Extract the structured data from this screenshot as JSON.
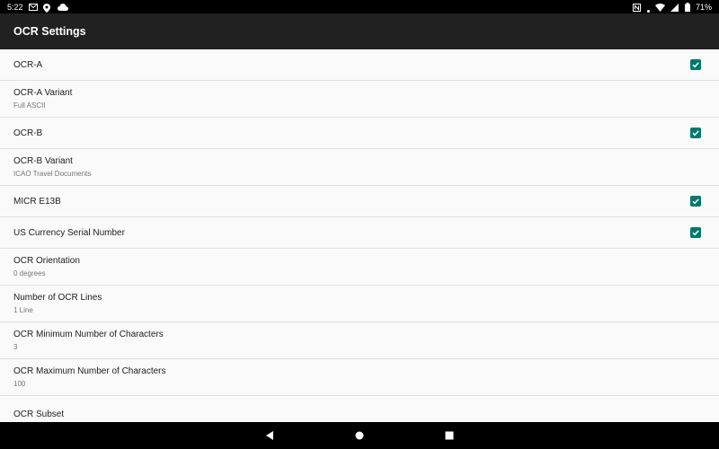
{
  "status_bar": {
    "time": "5:22",
    "battery": "71%",
    "left_icons": [
      "gmail-icon",
      "location-icon",
      "cloud-icon"
    ],
    "right_icons": [
      "nfc-icon",
      "dot-icon",
      "wifi-icon",
      "signal-icon",
      "battery-icon"
    ]
  },
  "app_bar": {
    "title": "OCR Settings"
  },
  "accent_color": "#00796b",
  "settings": {
    "items": [
      {
        "title": "OCR-A",
        "checked": true
      },
      {
        "title": "OCR-A Variant",
        "subtitle": "Full ASCII"
      },
      {
        "title": "OCR-B",
        "checked": true
      },
      {
        "title": "OCR-B Variant",
        "subtitle": "ICAO Travel Documents"
      },
      {
        "title": "MICR E13B",
        "checked": true
      },
      {
        "title": "US Currency Serial Number",
        "checked": true
      },
      {
        "title": "OCR Orientation",
        "subtitle": "0 degrees"
      },
      {
        "title": "Number of OCR Lines",
        "subtitle": "1 Line"
      },
      {
        "title": "OCR Minimum Number of Characters",
        "subtitle": "3"
      },
      {
        "title": "OCR Maximum Number of Characters",
        "subtitle": "100"
      },
      {
        "title": "OCR Subset"
      }
    ]
  },
  "nav_bar": {
    "buttons": [
      "back-icon",
      "home-icon",
      "recents-icon"
    ]
  }
}
